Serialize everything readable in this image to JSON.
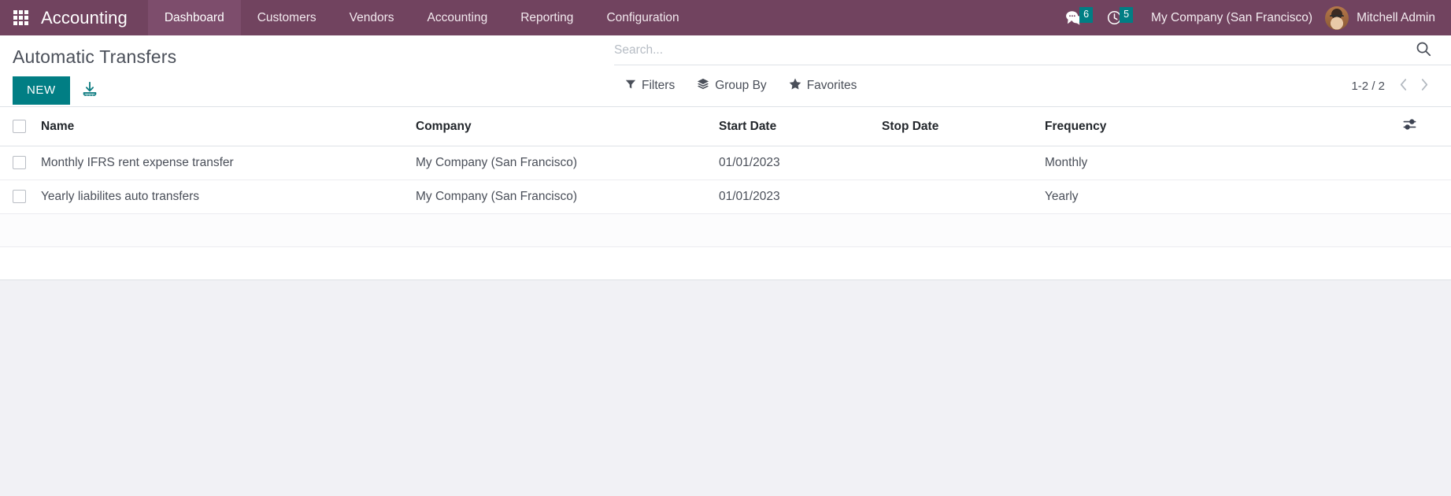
{
  "navbar": {
    "apps_icon": "apps-grid-icon",
    "brand": "Accounting",
    "menu": [
      {
        "label": "Dashboard",
        "active": true
      },
      {
        "label": "Customers",
        "active": false
      },
      {
        "label": "Vendors",
        "active": false
      },
      {
        "label": "Accounting",
        "active": false
      },
      {
        "label": "Reporting",
        "active": false
      },
      {
        "label": "Configuration",
        "active": false
      }
    ],
    "messages": {
      "icon": "comments-icon",
      "count": "6"
    },
    "activities": {
      "icon": "clock-icon",
      "count": "5"
    },
    "company": "My Company (San Francisco)",
    "user": {
      "name": "Mitchell Admin",
      "avatar": "user-avatar"
    },
    "colors": {
      "background": "#71435f",
      "active_item": "#7d4d6c",
      "badge": "#017e84"
    }
  },
  "control_panel": {
    "title": "Automatic Transfers",
    "new_button": "NEW",
    "import_icon": "import-download-icon",
    "search": {
      "placeholder": "Search...",
      "value": "",
      "icon": "search-icon"
    },
    "filter_buttons": [
      {
        "label": "Filters",
        "icon": "filter-funnel-icon"
      },
      {
        "label": "Group By",
        "icon": "layers-icon"
      },
      {
        "label": "Favorites",
        "icon": "star-icon"
      }
    ],
    "pager": {
      "value": "1-2 / 2",
      "previous_icon": "chevron-left-icon",
      "next_icon": "chevron-right-icon"
    },
    "colors": {
      "new_button": "#017e84"
    }
  },
  "list": {
    "columns": [
      {
        "key": "name",
        "label": "Name"
      },
      {
        "key": "company",
        "label": "Company"
      },
      {
        "key": "start_date",
        "label": "Start Date"
      },
      {
        "key": "stop_date",
        "label": "Stop Date"
      },
      {
        "key": "frequency",
        "label": "Frequency"
      }
    ],
    "optional_columns_icon": "sliders-options-icon",
    "rows": [
      {
        "name": "Monthly IFRS rent expense transfer",
        "company": "My Company (San Francisco)",
        "start_date": "01/01/2023",
        "stop_date": "",
        "frequency": "Monthly",
        "selected": false
      },
      {
        "name": "Yearly liabilites auto transfers",
        "company": "My Company (San Francisco)",
        "start_date": "01/01/2023",
        "stop_date": "",
        "frequency": "Yearly",
        "selected": false
      }
    ]
  }
}
